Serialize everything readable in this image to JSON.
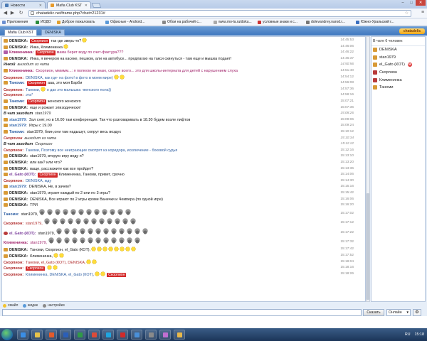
{
  "browser": {
    "tabs": [
      {
        "label": "Новости",
        "active": false
      },
      {
        "label": "Mafia Club KST",
        "active": true
      }
    ],
    "window_controls": [
      "–",
      "□",
      "✕"
    ],
    "url": "chatadelic.net/frame.php?chat=21231#",
    "bookmarks": [
      "Приложения",
      "ИОДО",
      "Доброе пожаловать",
      "Офисные - Android...",
      "Обои на рабочий с...",
      "www.mo-la.ru/doku...",
      "условные знаки и с...",
      "dolevandrey.narod.r...",
      "Южно-Уральский г..."
    ]
  },
  "site": {
    "tabs": [
      "Mafia Club KST",
      "DENISKA"
    ],
    "logo": "chatadelic"
  },
  "users_panel": {
    "header": "В чате 6 человек",
    "users": [
      {
        "name": "DENISKA",
        "color": "#d89a36"
      },
      {
        "name": "stan1979",
        "color": "#d89a36"
      },
      {
        "name": "el_Gato (КОТ)",
        "color": "#d89a36"
      },
      {
        "name": "Скорпион",
        "color": "#b83a3a"
      },
      {
        "name": "Клименинка",
        "color": "#b83a3a"
      },
      {
        "name": "Таноми",
        "color": "#d89a36"
      }
    ]
  },
  "messages": [
    {
      "avatar": "a",
      "name": "DENISKA:",
      "nc": "deniska",
      "tag": "Скорпион",
      "text": "так где зверь-то?",
      "tc": "",
      "smiles": 1,
      "time": "14:45:53"
    },
    {
      "avatar": "a",
      "name": "DENISKA:",
      "nc": "deniska",
      "tag": "",
      "text": "Инка, Клименинка",
      "tc": "",
      "smiles": 1,
      "time": "14:46:06"
    },
    {
      "avatar": "p",
      "name": "Клименинка:",
      "nc": "klim",
      "tag": "Скорпион",
      "text": "мама берет воду по счет-фактура???",
      "tc": "klim",
      "smiles": 0,
      "time": "14:46:22"
    },
    {
      "avatar": "a",
      "name": "DENISKA:",
      "nc": "deniska",
      "tag": "",
      "text": "Инка, я вечером на касеке, пешком, али на автобусе... предлагаю на такси скинуться - там еще и мышка подает!",
      "tc": "",
      "smiles": 0,
      "time": "14:46:37"
    },
    {
      "avatar": "",
      "name": "Инкой",
      "nc": "deniska",
      "tag": "",
      "text": "выходит из чата",
      "tc": "",
      "smiles": 0,
      "time": "14:50:56",
      "sys": true
    },
    {
      "avatar": "a",
      "name": "Клименинка:",
      "nc": "klim",
      "tag": "",
      "text": "Скорпион, ммммм...: я полюом не знаю, скорее всего... это для школы-интерната для детей с нарушением слуха",
      "tc": "klim",
      "smiles": 0,
      "time": "14:51:40"
    },
    {
      "avatar": "",
      "name": "Скорпион:",
      "nc": "skorp",
      "tag": "",
      "text": "DENISKA, как где- на фото! в фото в моем мире)",
      "tc": "blue",
      "smiles": 2,
      "time": "14:54:12"
    },
    {
      "avatar": "a",
      "name": "Таноми:",
      "nc": "tanom",
      "tag": "Скорпион",
      "text": "ааа, это моя Барби",
      "tc": "",
      "smiles": 0,
      "time": "14:56:08"
    },
    {
      "avatar": "",
      "name": "Скорпион:",
      "nc": "skorp",
      "tag": "",
      "text": "Таноми,",
      "tc": "blue",
      "smiles": 1,
      "text2": "о дак это малышка -женского пола))",
      "time": "14:57:36"
    },
    {
      "avatar": "",
      "name": "Скорпион:",
      "nc": "skorp",
      "tag": "",
      "text": "эта*",
      "tc": "blue",
      "smiles": 0,
      "time": "14:58:16"
    },
    {
      "avatar": "a",
      "name": "Таноми:",
      "nc": "tanom",
      "tag": "Скорпион",
      "text": "женского женского",
      "tc": "",
      "smiles": 0,
      "time": "15:07:21"
    },
    {
      "avatar": "a",
      "name": "DENISKA:",
      "nc": "deniska",
      "tag": "",
      "text": "еще и рожает эпизодически!",
      "tc": "",
      "smiles": 0,
      "time": "15:07:36"
    },
    {
      "avatar": "",
      "name": "В чат заходит",
      "nc": "deniska",
      "tag": "",
      "text": "stan1979",
      "tc": "",
      "smiles": 0,
      "time": "15:08:26",
      "sys": true
    },
    {
      "avatar": "a",
      "name": "stan1979:",
      "nc": "stan",
      "tag": "",
      "text": "Зал снят, но в 16.00 там конференция. Так что разговаривать в 18.30 будем возле лифтов",
      "tc": "",
      "smiles": 0,
      "time": "15:09:06"
    },
    {
      "avatar": "a",
      "name": "stan1979:",
      "nc": "stan",
      "tag": "",
      "text": "Игры с 19.00",
      "tc": "",
      "smiles": 0,
      "time": "15:09:24"
    },
    {
      "avatar": "a",
      "name": "Таноми:",
      "nc": "tanom",
      "tag": "",
      "text": "stan1979, блин,они там надышут, сопрут весь воздух",
      "tc": "",
      "smiles": 0,
      "time": "15:10:12"
    },
    {
      "avatar": "",
      "name": "Скорпион",
      "nc": "skorp",
      "tag": "",
      "text": "выходит из чата",
      "tc": "",
      "smiles": 0,
      "time": "15:10:34",
      "sys": true
    },
    {
      "avatar": "",
      "name": "В чат заходит",
      "nc": "deniska",
      "tag": "",
      "text": "Скорпион",
      "tc": "",
      "smiles": 0,
      "time": "15:11:12",
      "sys": true
    },
    {
      "avatar": "",
      "name": "Скорпион:",
      "nc": "skorp",
      "tag": "",
      "text": "Таноми, Поэтому все неиграющие смотрят из коридора, исключение - боковой судья",
      "tc": "blue",
      "smiles": 0,
      "time": "15:12:16"
    },
    {
      "avatar": "a",
      "name": "DENISKA:",
      "nc": "deniska",
      "tag": "",
      "text": "stan1979, вторую игру веду я?",
      "tc": "",
      "smiles": 0,
      "time": "15:13:10"
    },
    {
      "avatar": "a",
      "name": "DENISKA:",
      "nc": "deniska",
      "tag": "",
      "text": "или как? или что?",
      "tc": "",
      "smiles": 0,
      "time": "15:13:20"
    },
    {
      "avatar": "a",
      "name": "DENISKA:",
      "nc": "deniska",
      "tag": "",
      "text": "ваще, расскажите как все пройдет?",
      "tc": "",
      "smiles": 0,
      "time": "15:13:36"
    },
    {
      "avatar": "a",
      "name": "el_Gato (КОТ):",
      "nc": "elgato",
      "tag": "Скорпион",
      "text": "Клименинка, Таноми, привет, срочно",
      "tc": "",
      "smiles": 0,
      "time": "15:14:06"
    },
    {
      "avatar": "",
      "name": "Скорпион:",
      "nc": "skorp",
      "tag": "",
      "text": "DENISKA, жду",
      "tc": "blue",
      "smiles": 0,
      "time": "15:14:30"
    },
    {
      "avatar": "a",
      "name": "stan1979:",
      "nc": "stan",
      "tag": "",
      "text": "DENISKA, Не, в зачем?",
      "tc": "",
      "smiles": 0,
      "time": "15:15:16"
    },
    {
      "avatar": "a",
      "name": "DENISKA:",
      "nc": "deniska",
      "tag": "",
      "text": "stan1979, играет каждый по 2 или по 3 игры?",
      "tc": "",
      "smiles": 0,
      "time": "15:15:42"
    },
    {
      "avatar": "a",
      "name": "DENISKA:",
      "nc": "deniska",
      "tag": "",
      "text": "DENISKA, Все играют по 2 игры кроме Ванечки и Чемпера (по одной игре)",
      "tc": "",
      "smiles": 0,
      "time": "15:16:06"
    },
    {
      "avatar": "a",
      "name": "DENISKA:",
      "nc": "deniska",
      "tag": "",
      "text": "ТРИ",
      "tc": "",
      "smiles": 0,
      "time": "15:16:20"
    },
    {
      "avatar": "",
      "name": "Таноми:",
      "nc": "tanom",
      "tag": "",
      "text": "stan1979,",
      "tc": "",
      "smiles": 12,
      "smile_kind": "c",
      "time": "15:17:02",
      "tall": true
    },
    {
      "avatar": "",
      "name": "Скорпион:",
      "nc": "skorp",
      "tag": "",
      "text": "stan1979,",
      "tc": "red",
      "smiles": 12,
      "smile_kind": "c",
      "time": "15:17:12",
      "tall": true
    },
    {
      "avatar": "m",
      "name": "el_Gato (КОТ):",
      "nc": "elgato",
      "tag": "",
      "text": "stan1979,",
      "tc": "",
      "smiles": 12,
      "smile_kind": "c",
      "time": "15:17:22",
      "tall": true
    },
    {
      "avatar": "",
      "name": "Клименинка:",
      "nc": "klim",
      "tag": "",
      "text": "stan1979,",
      "tc": "klim",
      "smiles": 12,
      "smile_kind": "c",
      "time": "15:17:32",
      "tall": true
    },
    {
      "avatar": "a",
      "name": "DENISKA:",
      "nc": "deniska",
      "tag": "",
      "text": "Таноми, Скорпион, el_Gato (КОТ),",
      "tc": "",
      "smiles": 8,
      "smile_kind": "y",
      "time": "15:17:42"
    },
    {
      "avatar": "a",
      "name": "DENISKA:",
      "nc": "deniska",
      "tag": "",
      "text": "Клименинка,",
      "tc": "",
      "smiles": 2,
      "smile_kind": "y",
      "time": "15:17:52"
    },
    {
      "avatar": "",
      "name": "Скорпион:",
      "nc": "skorp",
      "tag": "",
      "text": "Таноми, el_Gato (КОТ), DENISKA,",
      "tc": "red",
      "smiles": 2,
      "smile_kind": "y",
      "time": "15:18:04"
    },
    {
      "avatar": "",
      "name": "Скорпион:",
      "nc": "skorp",
      "tag": "Скорпион",
      "text": "",
      "tc": "",
      "smiles": 2,
      "smile_kind": "y",
      "time": "15:18:16"
    },
    {
      "avatar": "",
      "name": "Скорпион:",
      "nc": "skorp",
      "tag": "",
      "text": "Клименинка, DENISKA, el_Gato (КОТ),",
      "tc": "blue",
      "tag2": "Скорпион",
      "smiles": 2,
      "smile_kind": "y",
      "time": "15:18:26"
    }
  ],
  "statusbar": {
    "items": [
      "смайл",
      "жидак",
      "настройки"
    ]
  },
  "input": {
    "value": "",
    "send_label": "Сказать",
    "lang_label": "Онлайн"
  },
  "taskbar": {
    "lang": "RU",
    "time": "15:18",
    "apps": [
      "ie",
      "explorer",
      "media",
      "word",
      "excel",
      "chrome",
      "skype",
      "opera",
      "mail",
      "calc",
      "paint",
      "folder"
    ]
  }
}
